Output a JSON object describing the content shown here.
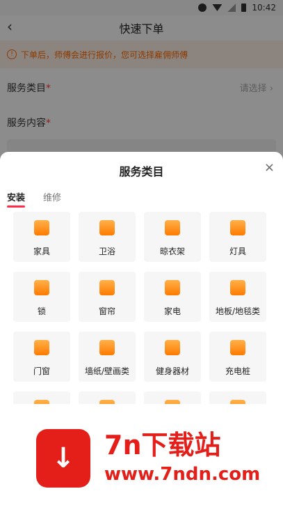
{
  "status": {
    "time": "10:42"
  },
  "nav": {
    "back": "‹",
    "title": "快速下单"
  },
  "notice": {
    "text": "下单后，师傅会进行报价，您可选择雇佣师傅"
  },
  "form": {
    "service_category": {
      "label": "服务类目",
      "required": "*",
      "value": "请选择 ›"
    },
    "service_content": {
      "label": "服务内容",
      "required": "*"
    }
  },
  "sheet": {
    "title": "服务类目",
    "close": "×",
    "tabs": [
      "安装",
      "维修"
    ],
    "items": [
      "家具",
      "卫浴",
      "晾衣架",
      "灯具",
      "锁",
      "窗帘",
      "家电",
      "地板/地毯类",
      "门窗",
      "墙纸/壁画类",
      "健身器材",
      "充电桩"
    ]
  },
  "watermark": {
    "brand": "7n下载站",
    "domain": "www.7ndn.com",
    "logo_icon": "↓"
  }
}
